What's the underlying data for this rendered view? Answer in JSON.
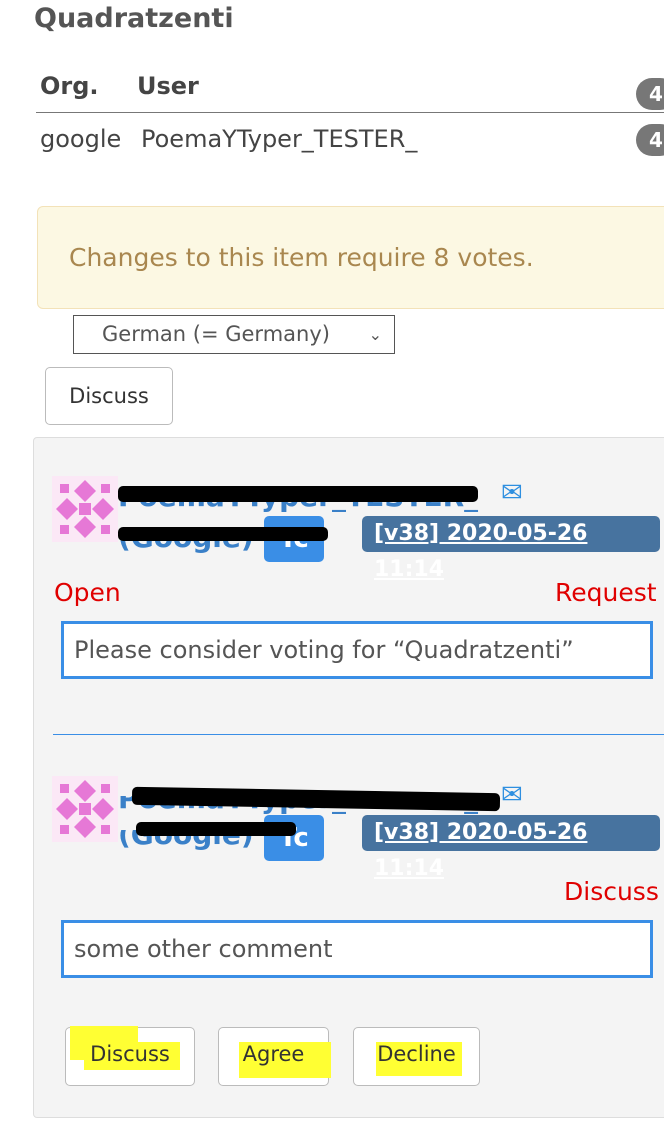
{
  "page": {
    "title": "Quadratzenti"
  },
  "table": {
    "headers": {
      "org": "Org.",
      "user": "User"
    },
    "header_badge": "4",
    "row": {
      "org": "google",
      "user": "PoemaYTyper_TESTER_",
      "badge": "4"
    }
  },
  "notice": {
    "text": "Changes to this item require 8 votes."
  },
  "locale_select": {
    "value": "German (= Germany)"
  },
  "discuss_button": "Discuss",
  "posts": [
    {
      "author": "PoemaYTyper_TESTER_",
      "org": "(Google)",
      "level": "Tc",
      "version_stamp": "[v38] 2020-05-26 11:14",
      "status_left": "Open",
      "status_right": "Request",
      "comment": "Please consider voting for “Quadratzenti”"
    },
    {
      "author": "PoemaYTyper_TESTER_",
      "org": "(Google)",
      "level": "Tc",
      "version_stamp": "[v38] 2020-05-26 11:14",
      "status_right": "Discuss",
      "comment": "some other comment"
    }
  ],
  "actions": {
    "discuss": "Discuss",
    "agree": "Agree",
    "decline": "Decline"
  },
  "icons": {
    "mail": "envelope-icon",
    "avatar": "identicon-avatar"
  },
  "colors": {
    "link": "#3a80c8",
    "stamp": "#47739f",
    "status": "#e00000",
    "highlight": "#ffff33"
  }
}
